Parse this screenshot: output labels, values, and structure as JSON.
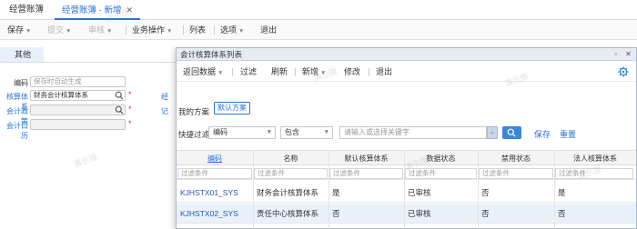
{
  "tabs": [
    {
      "label": "经营账簿",
      "active": false
    },
    {
      "label": "经营账簿 - 新增",
      "active": true
    }
  ],
  "toolbar": {
    "items": [
      {
        "label": "保存",
        "dropdown": true,
        "disabled": false
      },
      {
        "label": "提交",
        "dropdown": true,
        "disabled": true
      },
      {
        "label": "审核",
        "dropdown": true,
        "disabled": true
      },
      {
        "label": "业务操作",
        "dropdown": true,
        "disabled": false
      },
      {
        "label": "列表",
        "dropdown": false,
        "disabled": false
      },
      {
        "label": "选项",
        "dropdown": true,
        "disabled": false
      },
      {
        "label": "退出",
        "dropdown": false,
        "disabled": false
      }
    ]
  },
  "subtab": {
    "label": "其他"
  },
  "form": {
    "fields": [
      {
        "label": "编码",
        "value": "保存时自动生成",
        "placeholder": true
      },
      {
        "label": "核算体系",
        "value": "财务会计核算体系",
        "placeholder": false
      },
      {
        "label": "会计政策",
        "value": "",
        "placeholder": false
      },
      {
        "label": "会计日历",
        "value": "",
        "placeholder": false
      }
    ],
    "right_labels": [
      "经",
      "记"
    ],
    "required_mark": "*"
  },
  "dialog": {
    "title": "会计核算体系列表",
    "toolbar": [
      {
        "label": "返回数据",
        "dropdown": true
      },
      {
        "label": "过滤",
        "dropdown": false
      },
      {
        "label": "刷新",
        "dropdown": false
      },
      {
        "label": "新增",
        "dropdown": true
      },
      {
        "label": "修改",
        "dropdown": false
      },
      {
        "label": "退出",
        "dropdown": false
      }
    ],
    "my_scheme_label": "我的方案",
    "default_scheme_button": "默认方案",
    "quick_filter_label": "快捷过滤",
    "filter_field": "编码",
    "filter_operator": "包含",
    "keyword_placeholder": "请输入或选择关键字",
    "save_label": "保存",
    "reset_label": "重置",
    "columns": [
      "编码",
      "名称",
      "默认核算体系",
      "数据状态",
      "禁用状态",
      "法人核算体系"
    ],
    "filter_placeholder": "过滤条件",
    "rows": [
      {
        "code": "KJHSTX01_SYS",
        "name": "财务会计核算体系",
        "default": "是",
        "status": "已审核",
        "disabled": "否",
        "legal": "是"
      },
      {
        "code": "KJHSTX02_SYS",
        "name": "责任中心核算体系",
        "default": "否",
        "status": "已审核",
        "disabled": "否",
        "legal": "否"
      }
    ]
  },
  "watermark": "演示版",
  "colors": {
    "accent": "#2a73d6",
    "selected_row": "#e9f1fb",
    "search_button": "#3a86d9"
  }
}
